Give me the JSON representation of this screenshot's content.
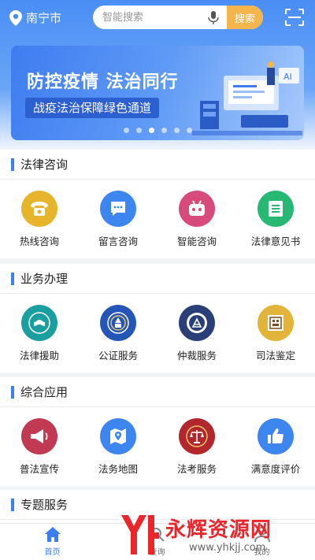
{
  "header": {
    "city": "南宁市",
    "search_placeholder": "智能搜索",
    "search_button": "搜索"
  },
  "banner": {
    "title": "防控疫情 法治同行",
    "subtitle": "战疫法治保障绿色通道",
    "dots": 6,
    "active_dot": 2
  },
  "sections": [
    {
      "title": "法律咨询",
      "items": [
        {
          "label": "热线咨询",
          "icon": "phone-icon",
          "color": "#e7b52c"
        },
        {
          "label": "留言咨询",
          "icon": "message-icon",
          "color": "#3d86f0"
        },
        {
          "label": "智能咨询",
          "icon": "robot-icon",
          "color": "#d64a7c"
        },
        {
          "label": "法律意见书",
          "icon": "document-icon",
          "color": "#27b873"
        }
      ]
    },
    {
      "title": "业务办理",
      "items": [
        {
          "label": "法律援助",
          "icon": "legal-aid-emblem-icon",
          "color": "#1a9ea0"
        },
        {
          "label": "公证服务",
          "icon": "notary-emblem-icon",
          "color": "#2456b8"
        },
        {
          "label": "仲裁服务",
          "icon": "arbitration-emblem-icon",
          "color": "#2a3f78"
        },
        {
          "label": "司法鉴定",
          "icon": "seal-stamp-icon",
          "color": "#e2b43a"
        }
      ]
    },
    {
      "title": "综合应用",
      "items": [
        {
          "label": "普法宣传",
          "icon": "megaphone-icon",
          "color": "#c23a52"
        },
        {
          "label": "法务地图",
          "icon": "map-icon",
          "color": "#3d86f0"
        },
        {
          "label": "法考服务",
          "icon": "scales-emblem-icon",
          "color": "#b2262e"
        },
        {
          "label": "满意度评价",
          "icon": "thumbs-up-icon",
          "color": "#3d86f0"
        }
      ]
    },
    {
      "title": "专题服务",
      "items": []
    }
  ],
  "tabbar": {
    "home": "首页",
    "query": "查询",
    "mine": "我的"
  },
  "watermark": {
    "brand": "永辉资源网",
    "url": "www.yhkjj.com"
  }
}
